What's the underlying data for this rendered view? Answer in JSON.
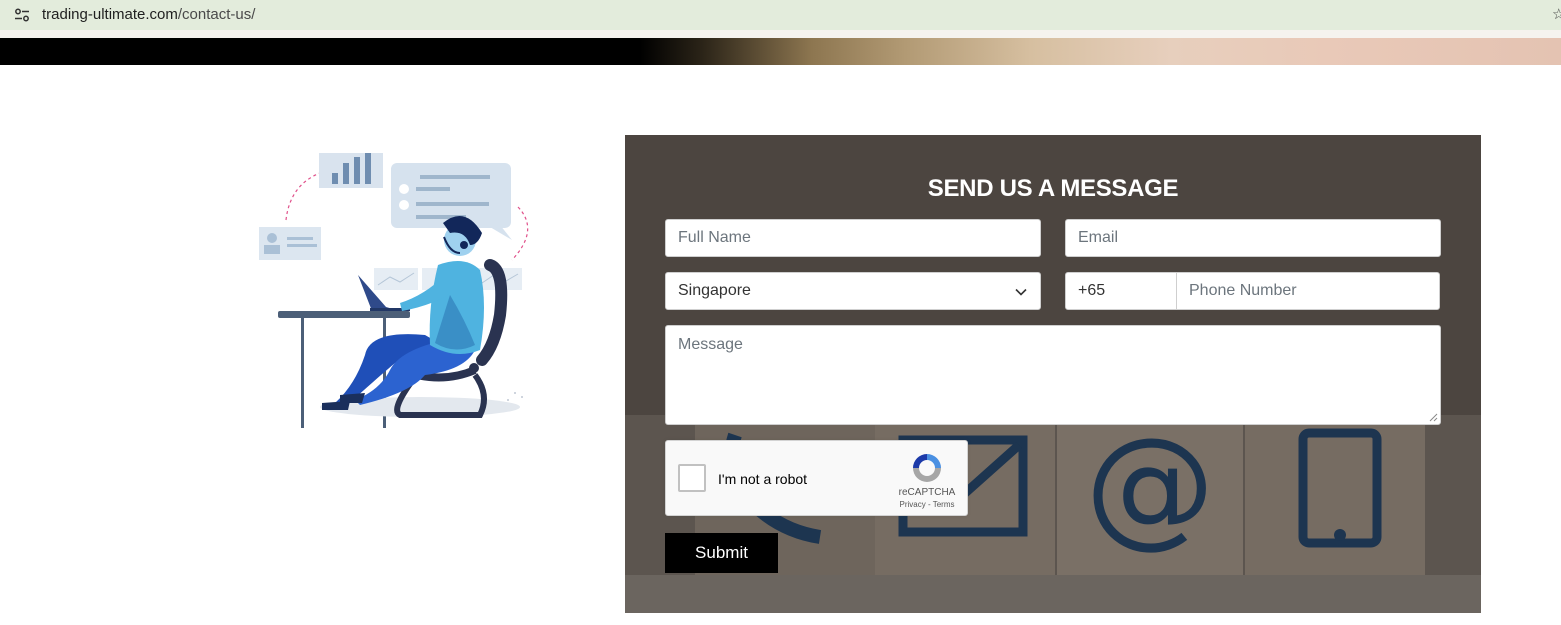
{
  "browser": {
    "url_host": "trading-ultimate.com",
    "url_path": "/contact-us/"
  },
  "form": {
    "title": "SEND US A MESSAGE",
    "full_name_placeholder": "Full Name",
    "email_placeholder": "Email",
    "country_value": "Singapore",
    "dial_code_value": "+65",
    "phone_placeholder": "Phone Number",
    "message_placeholder": "Message",
    "submit_label": "Submit"
  },
  "recaptcha": {
    "label": "I'm not a robot",
    "brand": "reCAPTCHA",
    "privacy": "Privacy",
    "separator": "-",
    "terms": "Terms"
  },
  "colors": {
    "address_bar": "#e3ecdc",
    "panel_overlay": "#4a433d",
    "submit_bg": "#000000",
    "illustration_blue": "#1f4fb8",
    "illustration_light_blue": "#4fb3e0"
  },
  "icons": [
    "tune-icon",
    "bookmark-star-icon",
    "chevron-down-icon",
    "recaptcha-logo-icon",
    "resize-grip-icon"
  ]
}
